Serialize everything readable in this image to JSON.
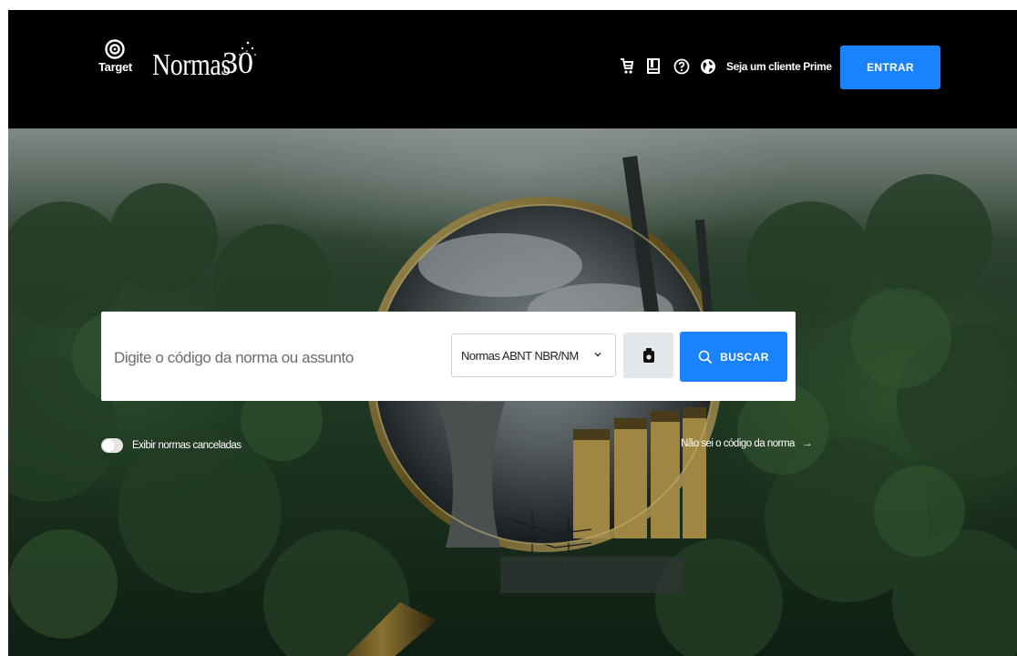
{
  "colors": {
    "header_bg": "#000000",
    "accent_blue": "#1a82fb",
    "hero_green": "#244229",
    "white": "#ffffff"
  },
  "header": {
    "logo_target_label": "Target",
    "logo_normas_text": "Normas",
    "logo_30_text": "30",
    "icons": [
      "cart-icon",
      "book-icon",
      "help-icon",
      "globe-icon"
    ],
    "prime_link": "Seja um cliente Prime",
    "login_button": "ENTRAR"
  },
  "search": {
    "placeholder": "Digite o código da norma ou assunto",
    "select_value": "Normas ABNT NBR/NM",
    "camera_icon": "camera-icon",
    "search_button": "BUSCAR",
    "toggle_label": "Exibir normas canceladas",
    "toggle_on": false,
    "help_link": "Não sei o código da norma",
    "help_link_arrow": "→"
  }
}
